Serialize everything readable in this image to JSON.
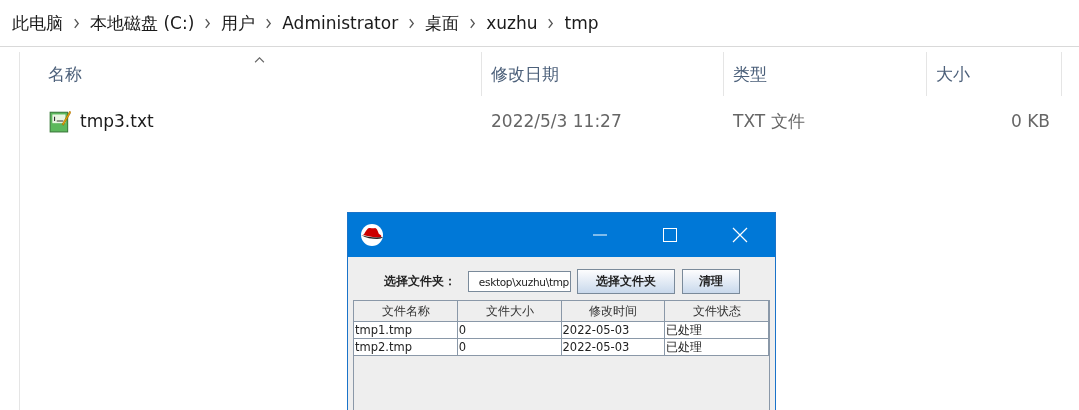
{
  "breadcrumb": [
    "此电脑",
    "本地磁盘 (C:)",
    "用户",
    "Administrator",
    "桌面",
    "xuzhu",
    "tmp"
  ],
  "file_list": {
    "columns": [
      {
        "label": "名称",
        "sorted": true
      },
      {
        "label": "修改日期",
        "sorted": false
      },
      {
        "label": "类型",
        "sorted": false
      },
      {
        "label": "大小",
        "sorted": false
      }
    ],
    "rows": [
      {
        "name": "tmp3.txt",
        "modified": "2022/5/3 11:27",
        "type": "TXT 文件",
        "size": "0 KB"
      }
    ]
  },
  "dialog": {
    "folder_label": "选择文件夹：",
    "folder_value": "esktop\\xuzhu\\tmp",
    "buttons": [
      "选择文件夹",
      "清理"
    ],
    "table": {
      "columns": [
        "文件名称",
        "文件大小",
        "修改时间",
        "文件状态"
      ],
      "rows": [
        [
          "tmp1.tmp",
          "0",
          "2022-05-03",
          "已处理"
        ],
        [
          "tmp2.tmp",
          "0",
          "2022-05-03",
          "已处理"
        ]
      ]
    }
  }
}
